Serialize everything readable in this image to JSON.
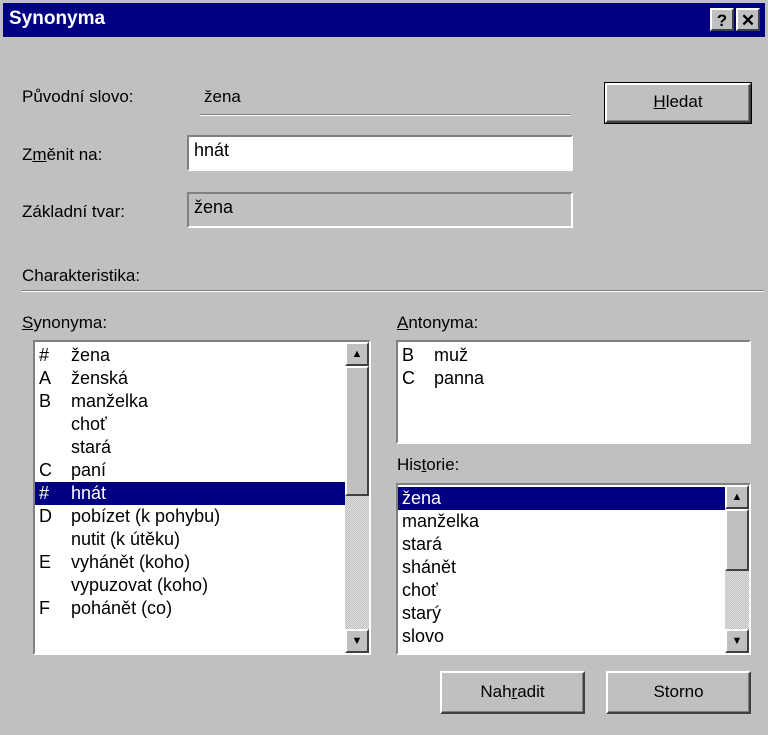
{
  "window": {
    "title": "Synonyma",
    "help_glyph": "?",
    "close_glyph": "✕"
  },
  "original_word": {
    "label": "Původní slovo:",
    "value": "žena"
  },
  "change_to": {
    "label_pre": "Z",
    "label_mnemonic": "m",
    "label_post": "ěnit na:",
    "value": "hnát"
  },
  "base_form": {
    "label": "Základní tvar:",
    "value": "žena"
  },
  "characteristics": {
    "label": "Charakteristika:"
  },
  "buttons": {
    "search_mnemonic": "H",
    "search_rest": "ledat",
    "replace_pre": "Nah",
    "replace_mnemonic": "r",
    "replace_post": "adit",
    "cancel": "Storno"
  },
  "synonyms": {
    "label_mnemonic": "S",
    "label_rest": "ynonyma:",
    "items": [
      {
        "code": "#",
        "word": "žena"
      },
      {
        "code": "A",
        "word": "ženská"
      },
      {
        "code": "B",
        "word": "manželka"
      },
      {
        "code": "",
        "word": "choť"
      },
      {
        "code": "",
        "word": "stará"
      },
      {
        "code": "C",
        "word": "paní"
      },
      {
        "code": "#",
        "word": "hnát"
      },
      {
        "code": "D",
        "word": "pobízet (k pohybu)"
      },
      {
        "code": "",
        "word": "nutit (k útěku)"
      },
      {
        "code": "E",
        "word": "vyhánět (koho)"
      },
      {
        "code": "",
        "word": "vypuzovat (koho)"
      },
      {
        "code": "F",
        "word": "pohánět (co)"
      }
    ],
    "selected_index": 6,
    "scroll_up_glyph": "▲",
    "scroll_down_glyph": "▼"
  },
  "antonyms": {
    "label_mnemonic": "A",
    "label_rest": "ntonyma:",
    "items": [
      {
        "code": "B",
        "word": "muž"
      },
      {
        "code": "C",
        "word": "panna"
      }
    ]
  },
  "history": {
    "label_pre": "His",
    "label_mnemonic": "t",
    "label_post": "orie:",
    "items": [
      "žena",
      "manželka",
      "stará",
      "shánět",
      "choť",
      "starý",
      "slovo"
    ],
    "selected_index": 0,
    "scroll_up_glyph": "▲",
    "scroll_down_glyph": "▼"
  }
}
